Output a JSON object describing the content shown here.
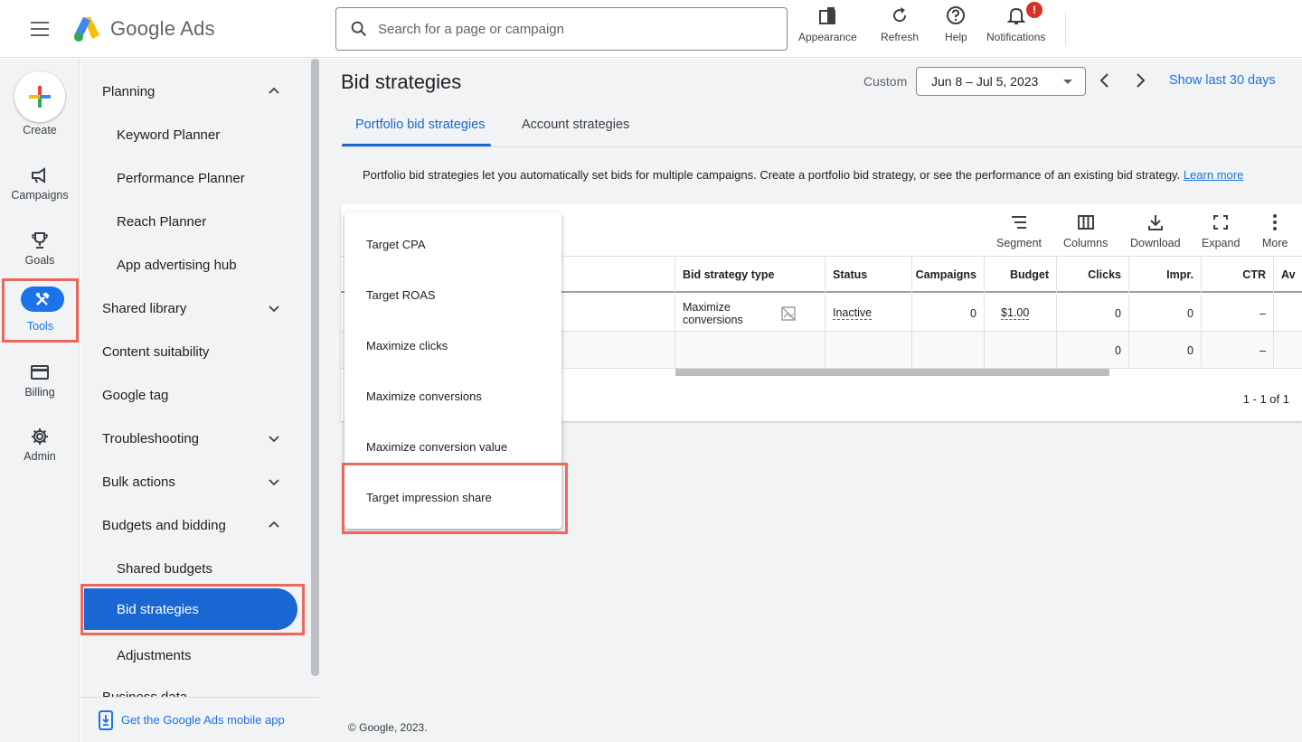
{
  "header": {
    "logo_text": "Google Ads",
    "search_placeholder": "Search for a page or campaign",
    "tools": [
      {
        "label": "Appearance"
      },
      {
        "label": "Refresh"
      },
      {
        "label": "Help"
      },
      {
        "label": "Notifications",
        "badge": "!"
      }
    ]
  },
  "rail": {
    "items": [
      {
        "label": "Create"
      },
      {
        "label": "Campaigns"
      },
      {
        "label": "Goals"
      },
      {
        "label": "Tools"
      },
      {
        "label": "Billing"
      },
      {
        "label": "Admin"
      }
    ]
  },
  "nav": {
    "items": [
      {
        "label": "Planning"
      },
      {
        "label": "Keyword Planner"
      },
      {
        "label": "Performance Planner"
      },
      {
        "label": "Reach Planner"
      },
      {
        "label": "App advertising hub"
      },
      {
        "label": "Shared library"
      },
      {
        "label": "Content suitability"
      },
      {
        "label": "Google tag"
      },
      {
        "label": "Troubleshooting"
      },
      {
        "label": "Bulk actions"
      },
      {
        "label": "Budgets and bidding"
      },
      {
        "label": "Shared budgets"
      },
      {
        "label": "Bid strategies"
      },
      {
        "label": "Adjustments"
      },
      {
        "label": "Business data"
      }
    ],
    "footer": "Get the Google Ads mobile app"
  },
  "main": {
    "title": "Bid strategies",
    "date_label": "Custom",
    "date_range": "Jun 8 – Jul 5, 2023",
    "show_last": "Show last 30 days",
    "tabs": [
      {
        "label": "Portfolio bid strategies"
      },
      {
        "label": "Account strategies"
      }
    ],
    "description": "Portfolio bid strategies let you automatically set bids for multiple campaigns. Create a portfolio bid strategy, or see the performance of an existing bid strategy.",
    "learn_more": "Learn more",
    "toolbar": [
      {
        "label": "Segment"
      },
      {
        "label": "Columns"
      },
      {
        "label": "Download"
      },
      {
        "label": "Expand"
      },
      {
        "label": "More"
      }
    ],
    "columns": [
      "Bid strategy type",
      "Status",
      "Campaigns",
      "Budget",
      "Clicks",
      "Impr.",
      "CTR",
      "Av"
    ],
    "rows": [
      {
        "type": "Maximize conversions",
        "status": "Inactive",
        "campaigns": "0",
        "budget": "$1.00",
        "clicks": "0",
        "impr": "0",
        "ctr": "–"
      },
      {
        "type": "",
        "status": "",
        "campaigns": "",
        "budget": "",
        "clicks": "0",
        "impr": "0",
        "ctr": "–"
      }
    ],
    "pager": "1 - 1 of 1",
    "copyright": "© Google, 2023."
  },
  "menu": {
    "items": [
      {
        "label": "Target CPA"
      },
      {
        "label": "Target ROAS"
      },
      {
        "label": "Maximize clicks"
      },
      {
        "label": "Maximize conversions"
      },
      {
        "label": "Maximize conversion value"
      },
      {
        "label": "Target impression share"
      }
    ]
  },
  "colors": {
    "accent": "#1a73e8",
    "active_nav": "#1967d2",
    "highlight_box": "#ee675c",
    "badge": "#d93025"
  }
}
